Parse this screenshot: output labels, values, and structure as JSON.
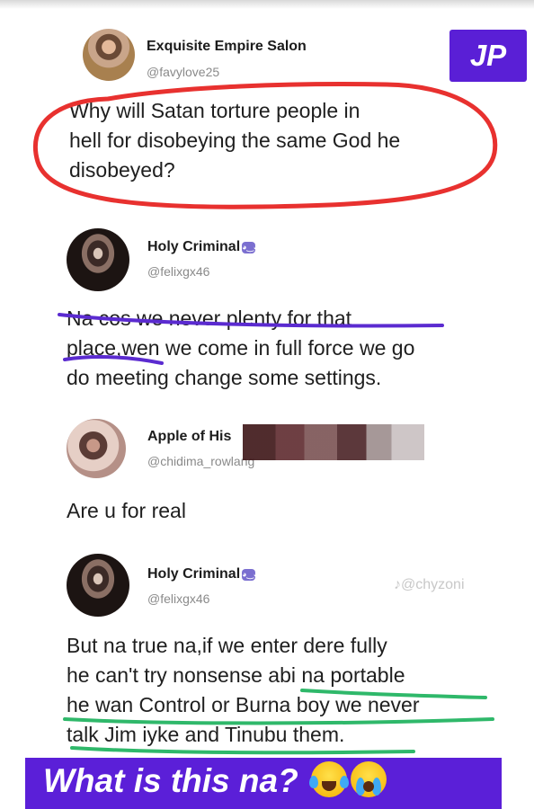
{
  "badge": {
    "label": "JP",
    "color": "#5a1fd6"
  },
  "posts": [
    {
      "display_name": "Exquisite Empire Salon",
      "handle": "@favylove25",
      "text_lines": [
        "Why will Satan torture people in",
        "hell for disobeying the same God he",
        "disobeyed?"
      ]
    },
    {
      "display_name": "Holy Criminal",
      "handle": "@felixgx46",
      "verified_icon": "devil-emoji-icon",
      "text_lines": [
        "Na cos we never plenty for that",
        "place,wen we come in full force we go",
        "do meeting change some settings."
      ]
    },
    {
      "display_name": "Apple of His",
      "handle": "@chidima_rowlang",
      "text_lines": [
        "Are u for real"
      ]
    },
    {
      "display_name": "Holy Criminal",
      "handle": "@felixgx46",
      "verified_icon": "devil-emoji-icon",
      "text_lines": [
        "But na true na,if we enter dere fully",
        "he can't try nonsense abi na portable",
        "he wan Control or Burna boy we never",
        "talk Jim iyke and  Tinubu them."
      ]
    }
  ],
  "watermark": "♪@chyzoni",
  "banner": {
    "text": "What is this na?",
    "emojis": [
      "laughing-crying-emoji-icon",
      "crying-emoji-icon"
    ],
    "color": "#5b1fd8"
  },
  "annotation_colors": {
    "red_circle": "#e8312f",
    "purple_underline": "#5b2bd0",
    "green_underline": "#2fb86a"
  }
}
